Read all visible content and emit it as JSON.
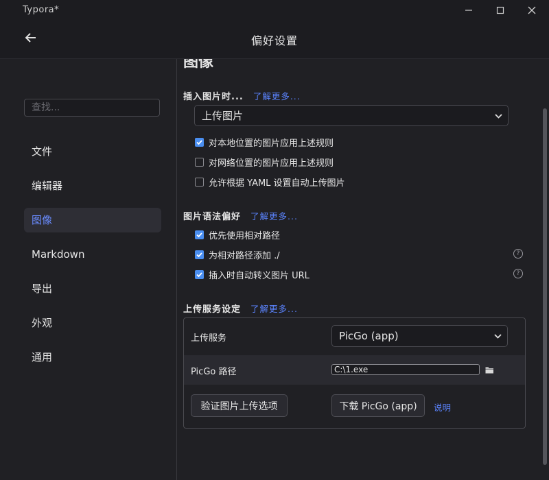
{
  "window": {
    "title": "Typora*"
  },
  "header": {
    "title": "偏好设置"
  },
  "sidebar": {
    "search_placeholder": "查找...",
    "items": [
      {
        "label": "文件"
      },
      {
        "label": "编辑器"
      },
      {
        "label": "图像",
        "active": true
      },
      {
        "label": "Markdown"
      },
      {
        "label": "导出"
      },
      {
        "label": "外观"
      },
      {
        "label": "通用"
      }
    ]
  },
  "content": {
    "page_heading": "图像",
    "insert_section": {
      "title": "插入图片时...",
      "learn_more": "了解更多...",
      "select_value": "上传图片",
      "options": [
        {
          "label": "对本地位置的图片应用上述规则",
          "checked": true
        },
        {
          "label": "对网络位置的图片应用上述规则",
          "checked": false
        },
        {
          "label": "允许根据 YAML 设置自动上传图片",
          "checked": false
        }
      ]
    },
    "syntax_section": {
      "title": "图片语法偏好",
      "learn_more": "了解更多...",
      "options": [
        {
          "label": "优先使用相对路径",
          "checked": true
        },
        {
          "label": "为相对路径添加 ./",
          "checked": true,
          "help": "?"
        },
        {
          "label": "插入时自动转义图片 URL",
          "checked": true,
          "help": "?"
        }
      ]
    },
    "upload_section": {
      "title": "上传服务设定",
      "learn_more": "了解更多...",
      "service_label": "上传服务",
      "service_value": "PicGo (app)",
      "path_label": "PicGo 路径",
      "path_value": "C:\\1.exe",
      "verify_button": "验证图片上传选项",
      "download_button": "下载 PicGo (app)",
      "explain_link": "说明"
    }
  },
  "icons": {
    "back": "arrow-left-icon",
    "minimize": "minimize-icon",
    "maximize": "maximize-icon",
    "close": "close-icon",
    "folder": "folder-icon",
    "chevron": "chevron-down-icon",
    "check": "checkmark-icon",
    "help": "question-circle-icon"
  },
  "colors": {
    "background": "#202024",
    "accent": "#5b84ff",
    "checkbox": "#4a8ef0",
    "active_nav_bg": "#2e2e35"
  }
}
